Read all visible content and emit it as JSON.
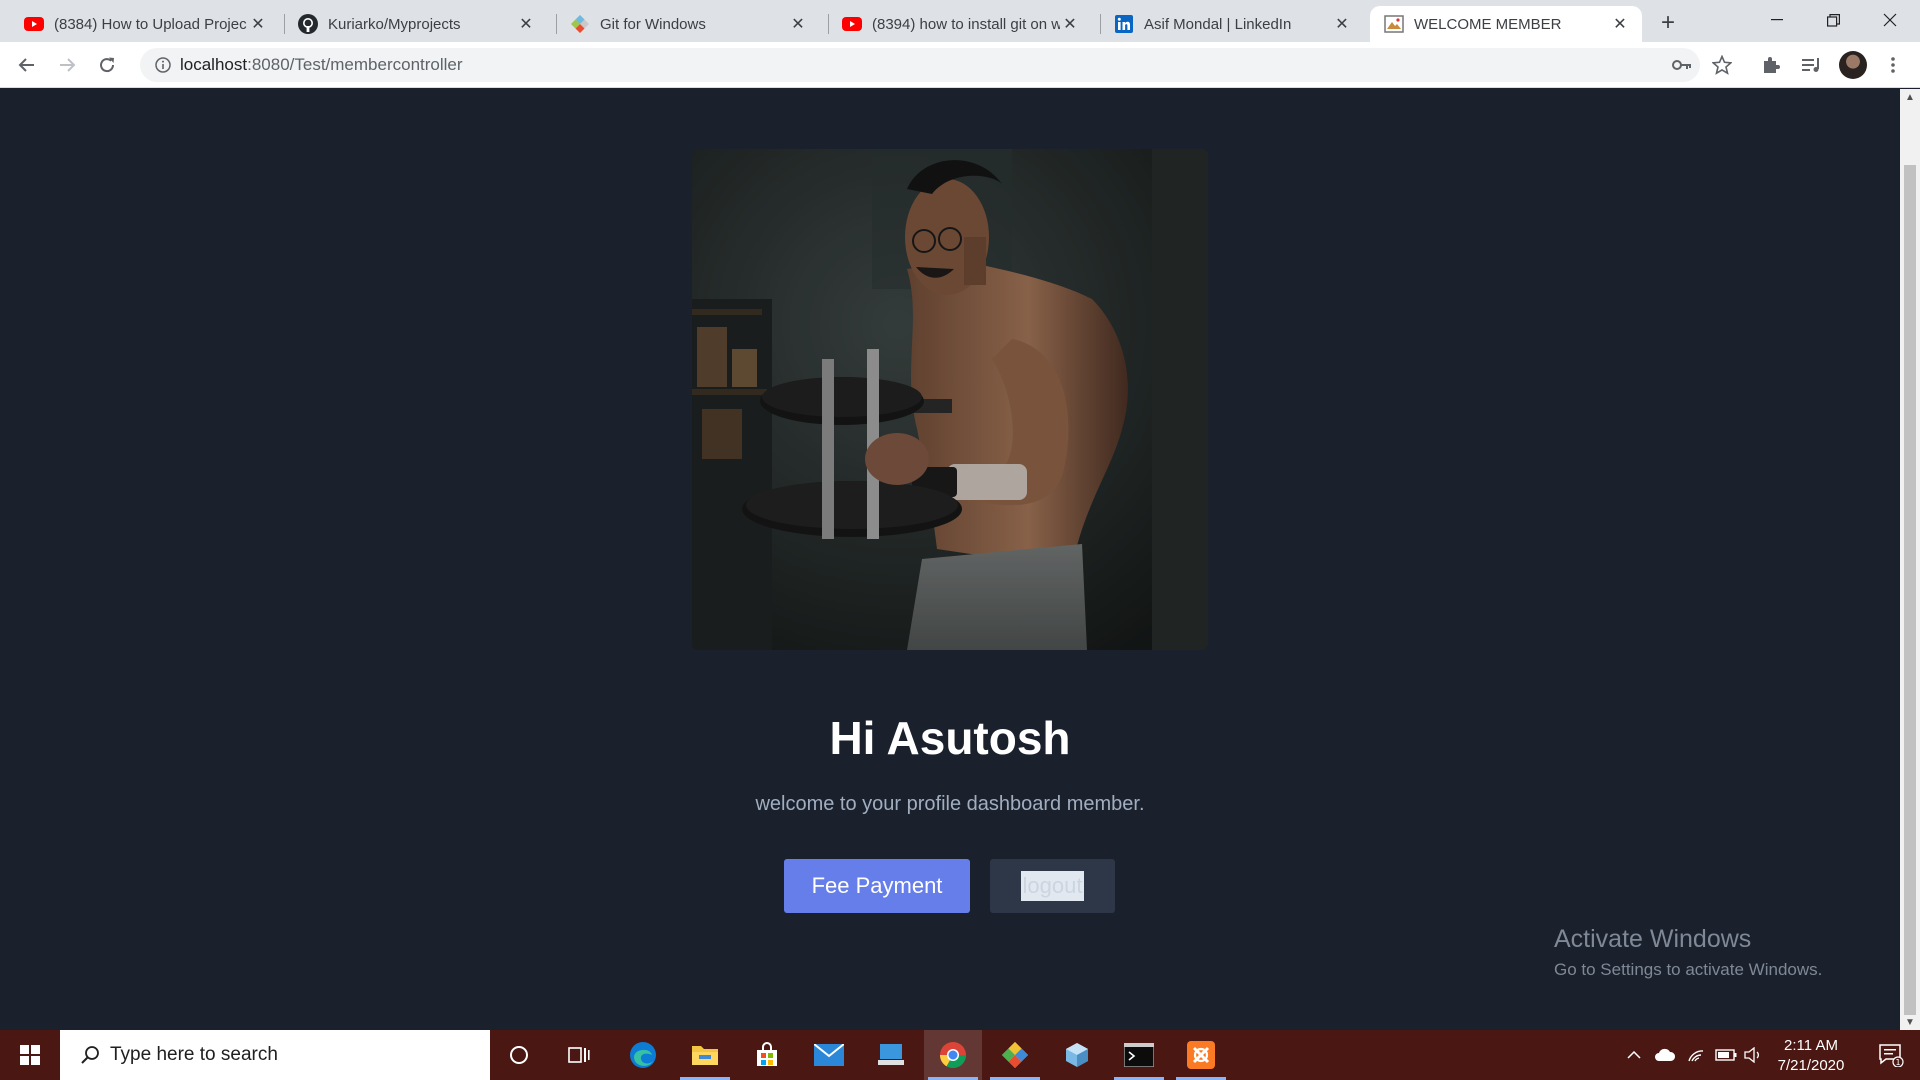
{
  "browser": {
    "tabs": [
      {
        "title": "(8384) How to Upload Projec",
        "icon": "youtube-icon"
      },
      {
        "title": "Kuriarko/Myprojects",
        "icon": "github-icon"
      },
      {
        "title": "Git for Windows",
        "icon": "git-icon"
      },
      {
        "title": "(8394) how to install git on w",
        "icon": "youtube-icon"
      },
      {
        "title": "Asif Mondal | LinkedIn",
        "icon": "linkedin-icon"
      },
      {
        "title": "WELCOME MEMBER",
        "icon": "page-icon"
      }
    ],
    "active_tab": 5,
    "url_host": "localhost",
    "url_path": ":8080/Test/membercontroller"
  },
  "page": {
    "greeting": "Hi Asutosh",
    "subtitle": "welcome to your profile dashboard member.",
    "fee_button": "Fee Payment",
    "logout_button": "logout"
  },
  "watermark": {
    "line1": "Activate Windows",
    "line2": "Go to Settings to activate Windows."
  },
  "taskbar": {
    "search_placeholder": "Type here to search",
    "time": "2:11 AM",
    "date": "7/21/2020",
    "notification_count": "1"
  },
  "colors": {
    "page_bg": "#1a202c",
    "primary_button": "#667eea",
    "secondary_button": "#2d3748",
    "taskbar": "#4a1712"
  }
}
